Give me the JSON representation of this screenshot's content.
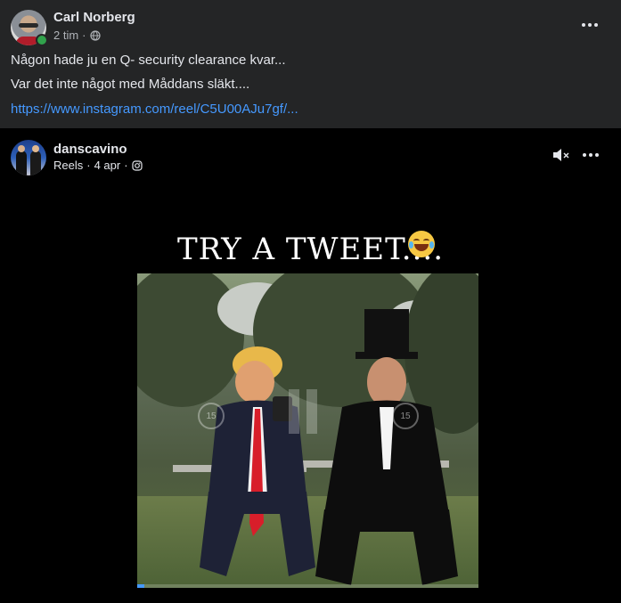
{
  "post": {
    "author": "Carl Norberg",
    "time": "2 tim",
    "separator": "·",
    "privacy_icon": "globe-icon",
    "lines": [
      "Någon hade ju en Q- security clearance kvar...",
      "Var det inte något med Måddans släkt...."
    ],
    "link": "https://www.instagram.com/reel/C5U00AJu7gf/..."
  },
  "embed": {
    "author": "danscavino",
    "type": "Reels",
    "date": "4 apr",
    "separator": "·",
    "source_icon": "instagram-icon",
    "mute_icon": "speaker-muted-icon",
    "caption": "TRY A TWEET....",
    "caption_emoji": "laughing-tears-emoji",
    "rewind_label": "15",
    "forward_label": "15",
    "progress": 0.02
  },
  "colors": {
    "post_bg": "#242526",
    "page_bg": "#000000",
    "link": "#4599ff",
    "online": "#31a24c"
  }
}
